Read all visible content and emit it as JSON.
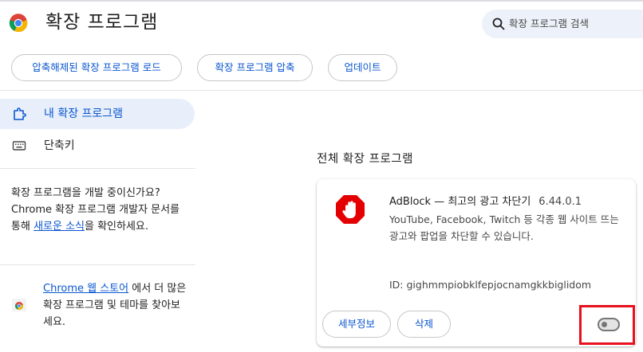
{
  "header": {
    "title": "확장 프로그램",
    "search_placeholder": "확장 프로그램 검색"
  },
  "toolbar": {
    "load_unpacked": "압축해제된 확장 프로그램 로드",
    "pack": "확장 프로그램 압축",
    "update": "업데이트"
  },
  "sidebar": {
    "items": [
      {
        "label": "내 확장 프로그램",
        "icon": "puzzle-icon",
        "active": true
      },
      {
        "label": "단축키",
        "icon": "keyboard-icon",
        "active": false
      }
    ],
    "dev_text_before": "확장 프로그램을 개발 중이신가요? Chrome 확장 프로그램 개발자 문서를 통해 ",
    "dev_link": "새로운 소식",
    "dev_text_after": "을 확인하세요.",
    "store_link": "Chrome 웹 스토어",
    "store_text": " 에서 더 많은 확장 프로그램 및 테마를 찾아보세요."
  },
  "main": {
    "section_title": "전체 확장 프로그램",
    "extension": {
      "name": "AdBlock — 최고의 광고 차단기",
      "version": "6.44.0.1",
      "description": "YouTube, Facebook, Twitch 등 각종 웹 사이트 뜨는 광고와 팝업을 차단할 수 있습니다.",
      "id_text": "ID: gighmmpiobklfepjocnamgkkbiglidom",
      "details_label": "세부정보",
      "remove_label": "삭제",
      "enabled": false,
      "icon": "adblock-hand-icon"
    }
  },
  "colors": {
    "accent": "#0b57d0",
    "highlight": "#e8101e",
    "adblock_red": "#e40000"
  }
}
